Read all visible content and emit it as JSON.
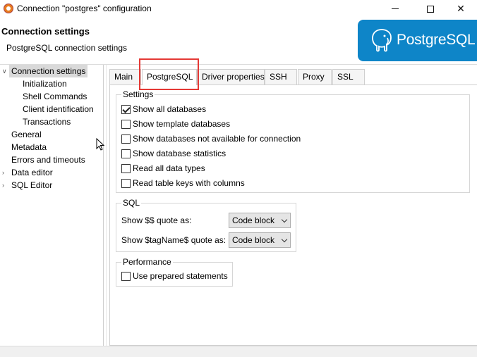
{
  "window": {
    "title": "Connection \"postgres\" configuration",
    "close_glyph": "✕"
  },
  "header": {
    "title": "Connection settings",
    "subtitle": "PostgreSQL connection settings",
    "logo_text": "PostgreSQL",
    "logo_color": "#0e85c8"
  },
  "tree": {
    "items": [
      {
        "label": "Connection settings",
        "selected": true
      },
      {
        "label": "Initialization"
      },
      {
        "label": "Shell Commands"
      },
      {
        "label": "Client identification"
      },
      {
        "label": "Transactions"
      },
      {
        "label": "General"
      },
      {
        "label": "Metadata"
      },
      {
        "label": "Errors and timeouts"
      },
      {
        "label": "Data editor"
      },
      {
        "label": "SQL Editor"
      }
    ],
    "expanders": [
      "∨",
      "›",
      "›"
    ]
  },
  "tabs": [
    {
      "label": "Main"
    },
    {
      "label": "PostgreSQL",
      "active": true
    },
    {
      "label": "Driver properties"
    },
    {
      "label": "SSH"
    },
    {
      "label": "Proxy"
    },
    {
      "label": "SSL"
    }
  ],
  "settings_group": {
    "label": "Settings",
    "options": [
      {
        "label": "Show all databases",
        "checked": true
      },
      {
        "label": "Show template databases",
        "checked": false
      },
      {
        "label": "Show databases not available for connection",
        "checked": false
      },
      {
        "label": "Show database statistics",
        "checked": false
      },
      {
        "label": "Read all data types",
        "checked": false
      },
      {
        "label": "Read table keys with columns",
        "checked": false
      }
    ]
  },
  "sql_group": {
    "label": "SQL",
    "rows": [
      {
        "label": "Show $$ quote as:",
        "value": "Code block"
      },
      {
        "label": "Show $tagName$ quote as:",
        "value": "Code block"
      }
    ]
  },
  "performance_group": {
    "label": "Performance",
    "options": [
      {
        "label": "Use prepared statements",
        "checked": false
      }
    ]
  },
  "colors": {
    "highlight": "#e53935",
    "selection": "#d9d9d9"
  }
}
